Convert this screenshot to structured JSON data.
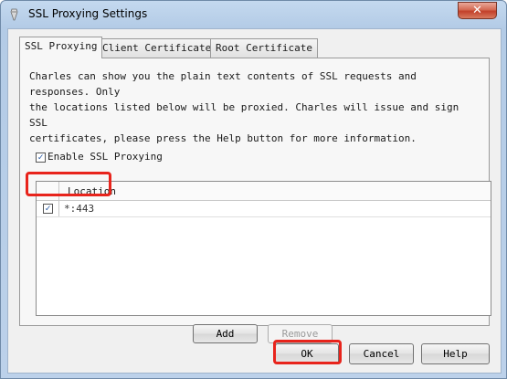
{
  "window": {
    "title": "SSL Proxying Settings",
    "close_glyph": "✕",
    "icon": "charles-app-icon"
  },
  "tabs": [
    {
      "label": "SSL Proxying",
      "active": true
    },
    {
      "label": "Client Certificates",
      "active": false
    },
    {
      "label": "Root Certificate",
      "active": false
    }
  ],
  "ssl_tab": {
    "description": "Charles can show you the plain text contents of SSL requests and responses. Only\nthe locations listed below will be proxied. Charles will issue and sign SSL\ncertificates, please press the Help button for more information.",
    "enable_label": "Enable SSL Proxying",
    "enable_checked": true,
    "table": {
      "column_header": "Location",
      "rows": [
        {
          "checked": true,
          "location": "*:443"
        }
      ]
    },
    "add_label": "Add",
    "remove_label": "Remove"
  },
  "footer": {
    "ok_label": "OK",
    "cancel_label": "Cancel",
    "help_label": "Help"
  },
  "colors": {
    "highlight": "#e8241c",
    "check": "#1a4fa0"
  },
  "check_glyph": "✓"
}
